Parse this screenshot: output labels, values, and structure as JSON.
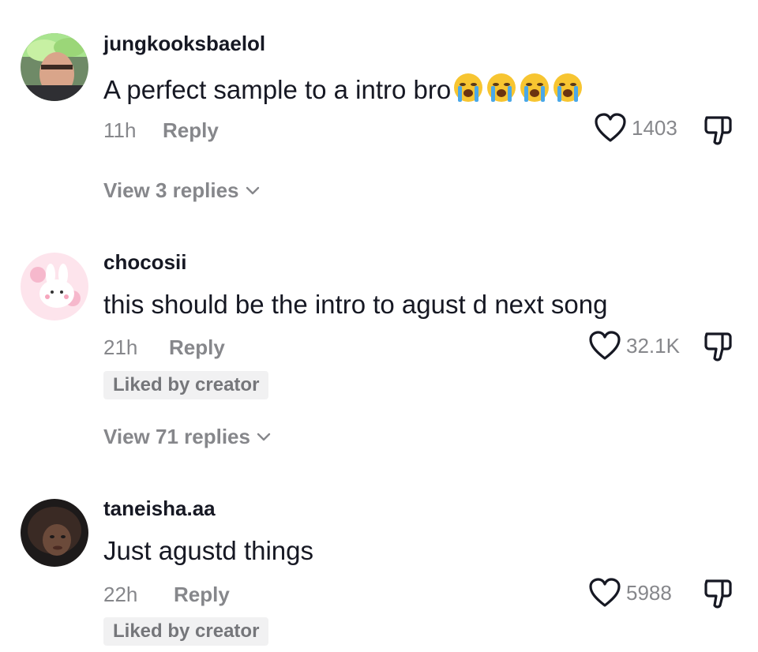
{
  "comments": [
    {
      "username": "jungkooksbaelol",
      "text": "A perfect sample to a intro bro",
      "emojis": [
        "😭",
        "😭",
        "😭",
        "😭"
      ],
      "time": "11h",
      "reply_label": "Reply",
      "likes": "1403",
      "liked_by_creator": false,
      "view_replies": "View 3 replies"
    },
    {
      "username": "chocosii",
      "text": "this should be the intro to agust d next song",
      "time": "21h",
      "reply_label": "Reply",
      "likes": "32.1K",
      "liked_by_creator": true,
      "badge": "Liked by creator",
      "view_replies": "View 71 replies"
    },
    {
      "username": "taneisha.aa",
      "text": "Just agustd things",
      "time": "22h",
      "reply_label": "Reply",
      "likes": "5988",
      "liked_by_creator": true,
      "badge": "Liked by creator"
    }
  ],
  "icons": {
    "like": "heart-outline-icon",
    "dislike": "thumbs-down-icon",
    "expand": "chevron-down-icon",
    "emoji": "loudly-crying-face-emoji"
  },
  "colors": {
    "primary_text": "#161823",
    "secondary_text": "#86878b",
    "badge_bg": "#f1f1f2",
    "icon_stroke": "#161823"
  }
}
